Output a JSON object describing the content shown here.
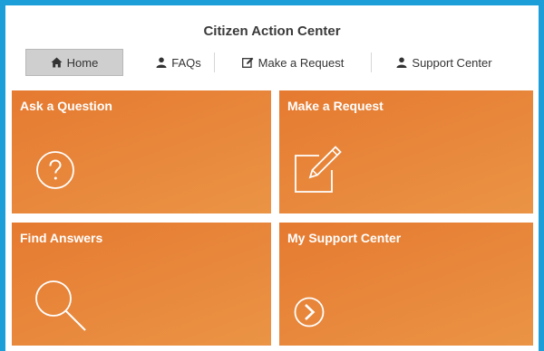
{
  "app": {
    "title": "Citizen Action Center"
  },
  "nav": {
    "items": [
      {
        "label": "Home",
        "icon": "home-icon"
      },
      {
        "label": "FAQs",
        "icon": "user-icon"
      },
      {
        "label": "Make a Request",
        "icon": "edit-icon"
      },
      {
        "label": "Support Center",
        "icon": "user-icon"
      }
    ]
  },
  "tiles": [
    {
      "label": "Ask a Question",
      "icon": "question-circle-icon"
    },
    {
      "label": "Make a Request",
      "icon": "edit-square-icon"
    },
    {
      "label": "Find Answers",
      "icon": "magnifier-icon"
    },
    {
      "label": "My Support Center",
      "icon": "chevron-right-circle-icon"
    }
  ],
  "colors": {
    "frame_border": "#1c9fd9",
    "tile_orange": "#e8883c",
    "active_nav": "#cfcfcf"
  }
}
